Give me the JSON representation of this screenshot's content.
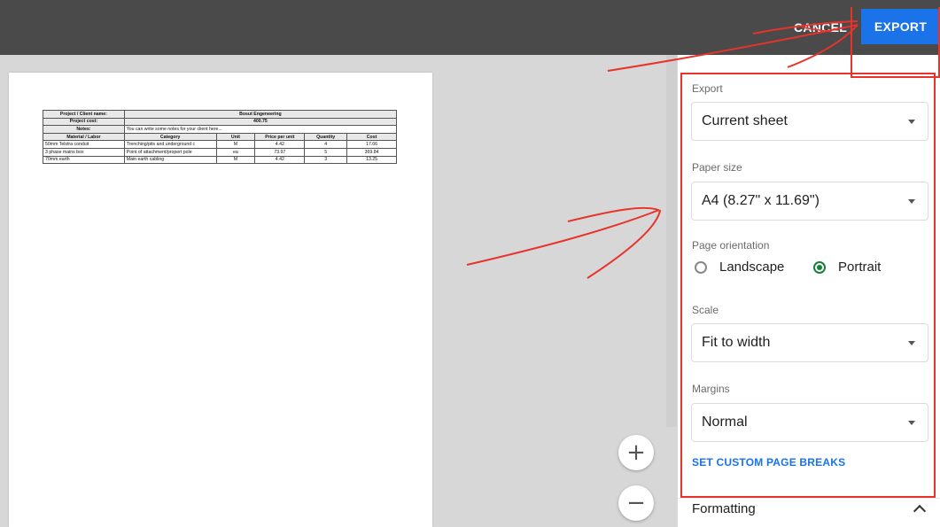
{
  "toolbar": {
    "cancel_label": "CANCEL",
    "export_label": "EXPORT"
  },
  "sheet": {
    "project_label": "Project / Client name:",
    "project_value": "Bosut Engeneering",
    "cost_label": "Project cost:",
    "cost_value": "400.75",
    "notes_label": "Notes:",
    "notes_value": "You can write some notes for your client here...",
    "headers": [
      "Material / Labor",
      "Category",
      "Unit",
      "Price per unit",
      "Quantity",
      "Cost"
    ],
    "rows": [
      [
        "50mm Telstra conduit",
        "Trenching/pits and underground c",
        "M",
        "4.42",
        "4",
        "17.66"
      ],
      [
        "3 phase mains box",
        "Point of attachment/propert pole",
        "ea",
        "73.97",
        "5",
        "369.84"
      ],
      [
        "70mm earth",
        "Main earth cabling",
        "M",
        "4.42",
        "3",
        "13.25"
      ]
    ]
  },
  "zoom": {
    "in_symbol": "+",
    "out_symbol": "−"
  },
  "panel": {
    "export_label": "Export",
    "export_value": "Current sheet",
    "paper_label": "Paper size",
    "paper_value": "A4 (8.27\" x 11.69\")",
    "orientation_label": "Page orientation",
    "orientation_options": [
      "Landscape",
      "Portrait"
    ],
    "orientation_selected": "Portrait",
    "scale_label": "Scale",
    "scale_value": "Fit to width",
    "margins_label": "Margins",
    "margins_value": "Normal",
    "custom_breaks_label": "SET CUSTOM PAGE BREAKS",
    "formatting_label": "Formatting"
  },
  "colors": {
    "accent": "#1a73e8",
    "annotation": "#e8332a",
    "radio_selected": "#188038",
    "topbar": "#4a4a4a"
  }
}
